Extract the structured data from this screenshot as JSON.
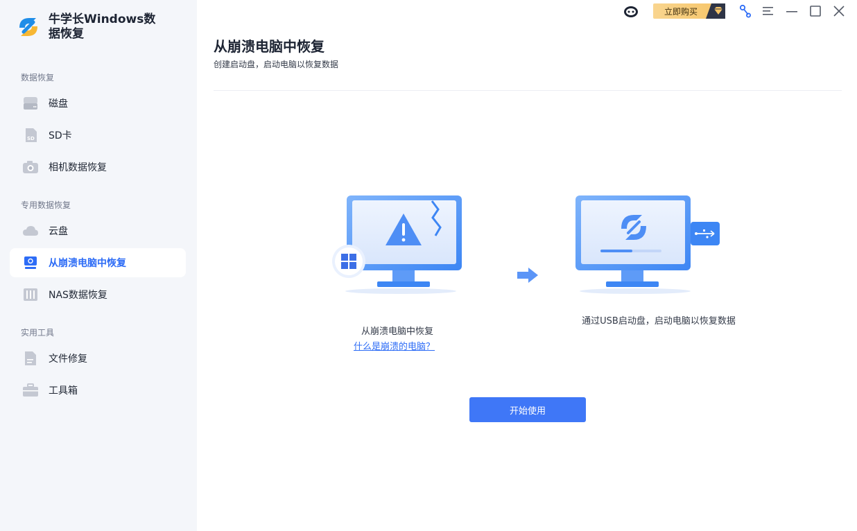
{
  "app": {
    "name": "牛学长Windows数据恢复"
  },
  "titlebar": {
    "buy_label": "立即购买"
  },
  "sidebar": {
    "sections": [
      {
        "title": "数据恢复",
        "items": [
          {
            "label": "磁盘",
            "icon": "disk-icon"
          },
          {
            "label": "SD卡",
            "icon": "sd-card-icon"
          },
          {
            "label": "相机数据恢复",
            "icon": "camera-icon"
          }
        ]
      },
      {
        "title": "专用数据恢复",
        "items": [
          {
            "label": "云盘",
            "icon": "cloud-icon"
          },
          {
            "label": "从崩溃电脑中恢复",
            "icon": "crashed-computer-icon",
            "active": true
          },
          {
            "label": "NAS数据恢复",
            "icon": "nas-icon"
          }
        ]
      },
      {
        "title": "实用工具",
        "items": [
          {
            "label": "文件修复",
            "icon": "file-repair-icon"
          },
          {
            "label": "工具箱",
            "icon": "toolbox-icon"
          }
        ]
      }
    ]
  },
  "main": {
    "title": "从崩溃电脑中恢复",
    "subtitle": "创建启动盘，启动电脑以恢复数据",
    "step1_caption": "从崩溃电脑中恢复",
    "step1_link": "什么是崩溃的电脑？",
    "step2_caption": "通过USB启动盘，启动电脑以恢复数据",
    "start_button": "开始使用"
  },
  "colors": {
    "accent": "#2d6cf6",
    "sidebar_bg": "#f4f6fa",
    "buy_gold": "#f6c466"
  }
}
